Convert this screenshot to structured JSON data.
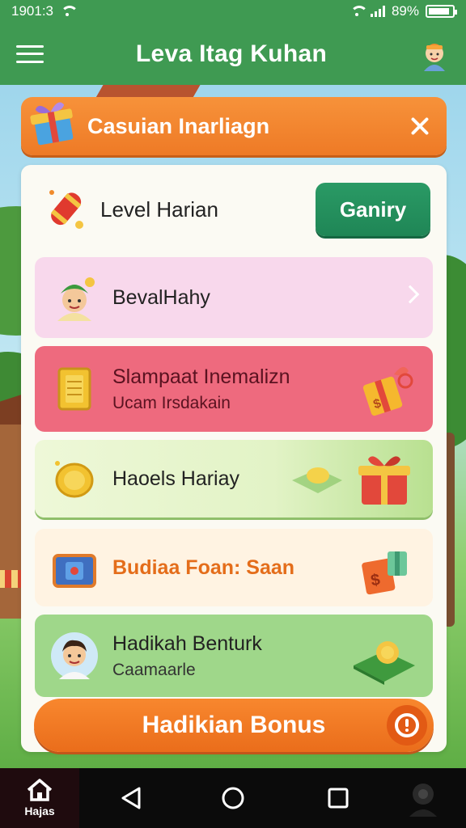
{
  "status_bar": {
    "time": "1901:3",
    "battery": "89%",
    "battery_level": 0.89
  },
  "app_bar": {
    "title": "Leva Itag Kuhan",
    "menu_icon": "hamburger-menu-icon",
    "avatar_icon": "profile-avatar-icon"
  },
  "banner": {
    "title": "Casuian Inarliagn",
    "icon": "gift-box-icon",
    "close_icon": "close-icon"
  },
  "level_row": {
    "label": "Level Harian",
    "button_label": "Ganiry",
    "icon": "firecracker-icon"
  },
  "cards": [
    {
      "title": "BevalHahy",
      "subtitle": "",
      "icon": "character-avatar-icon",
      "deco": "chevron-right-icon",
      "bg": "#f8d8ec"
    },
    {
      "title": "Slampaat Inemalizn",
      "subtitle": "Ucam Irsdakain",
      "icon": "gold-bar-icon",
      "deco": "gift-tag-icon",
      "bg": "#ee6a7e"
    },
    {
      "title": "Haoels Hariay",
      "subtitle": "",
      "icon": "coin-icon",
      "deco": "gift-box-icon",
      "bg": "#e2f3c6"
    },
    {
      "title": "Budiaa Foan: Saan",
      "subtitle": "",
      "icon": "treasure-chest-icon",
      "deco": "gift-box-icon",
      "bg": "#fff3e2"
    },
    {
      "title": "Hadikah Benturk",
      "subtitle": "Caamaarle",
      "icon": "boy-avatar-icon",
      "deco": "star-tile-icon",
      "bg": "#9fd78a"
    }
  ],
  "bonus_button": {
    "label": "Hadikian Bonus",
    "icon": "alert-icon"
  },
  "nav_bar": {
    "home_label": "Hajas",
    "items": [
      "back-icon",
      "home-circle-icon",
      "recents-icon",
      "assistant-icon"
    ]
  },
  "colors": {
    "primary_green": "#3f9a52",
    "accent_orange": "#ee7a26",
    "play_green": "#1f8656"
  }
}
